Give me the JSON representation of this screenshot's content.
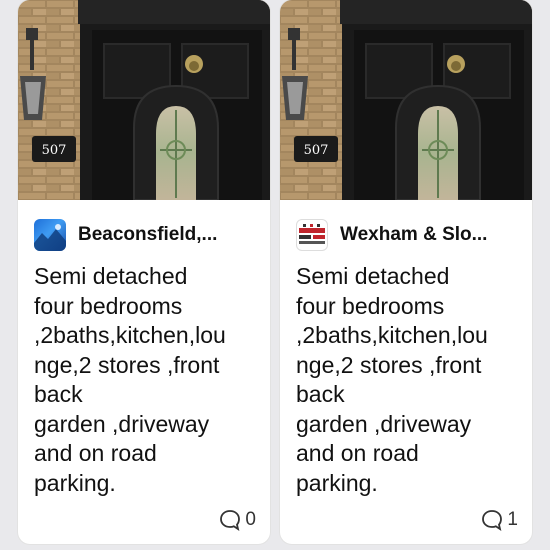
{
  "posts": [
    {
      "author": "Beaconsfield,...",
      "description": "Semi detached\nfour bedrooms\n,2baths,kitchen,lou\nnge,2 stores ,front\nback\ngarden ,driveway\nand on road\nparking.",
      "house_number": "507",
      "comment_count": "0",
      "avatar_icon": "blue-landscape-icon"
    },
    {
      "author": "Wexham & Slo...",
      "description": "Semi detached\nfour bedrooms\n,2baths,kitchen,lou\nnge,2 stores ,front\nback\ngarden ,driveway\nand on road\nparking.",
      "house_number": "507",
      "comment_count": "1",
      "avatar_icon": "community-logo-icon"
    }
  ],
  "colors": {
    "card": "#ffffff",
    "background": "#e9e9ec",
    "door": "#151515",
    "brick": "#a4865d"
  }
}
